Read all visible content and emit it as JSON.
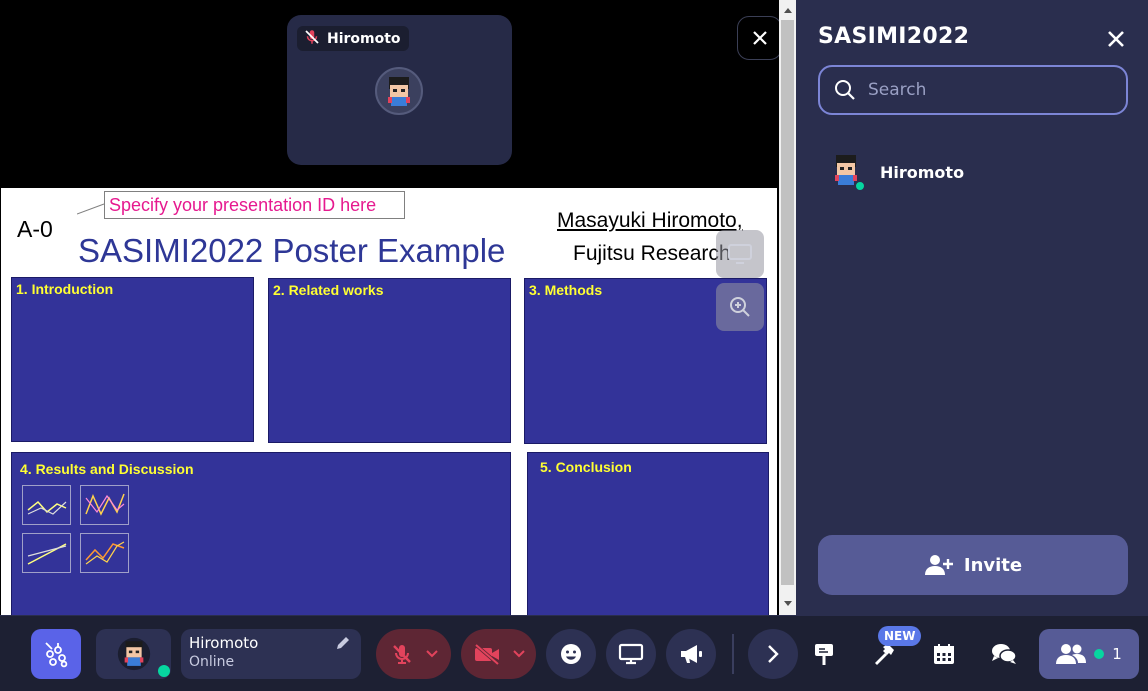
{
  "video": {
    "participant_name": "Hiromoto"
  },
  "poster": {
    "id": "A-0",
    "callout": "Specify your presentation ID here",
    "title": "SASIMI2022 Poster Example",
    "author": "Masayuki Hiromoto,",
    "affiliation": "Fujitsu Research",
    "sections": [
      {
        "label": "1. Introduction"
      },
      {
        "label": "2. Related works"
      },
      {
        "label": "3. Methods"
      },
      {
        "label": "4. Results and Discussion"
      },
      {
        "label": "5. Conclusion"
      }
    ]
  },
  "sidebar": {
    "space_title": "SASIMI2022",
    "search_placeholder": "Search",
    "members": [
      {
        "name": "Hiromoto",
        "status": "online"
      }
    ],
    "invite_label": "Invite"
  },
  "bottombar": {
    "user_name": "Hiromoto",
    "user_status": "Online",
    "new_badge": "NEW",
    "participant_count": "1"
  },
  "colors": {
    "accent": "#5a63e8",
    "online": "#06d6a0",
    "muted_red": "#5e2634",
    "poster_blue": "#333399",
    "section_title_yellow": "#ffff33",
    "callout_pink": "#e6198f"
  }
}
